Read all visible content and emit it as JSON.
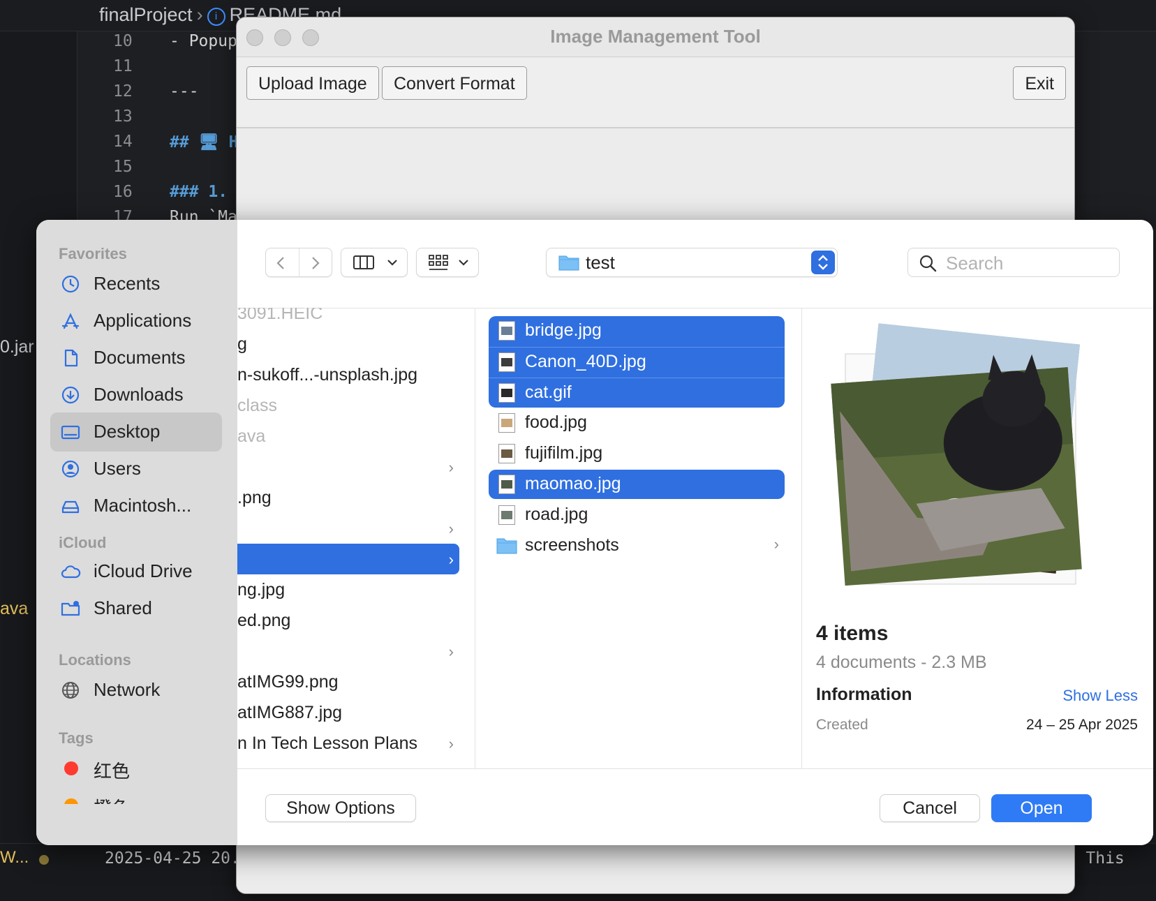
{
  "editor": {
    "breadcrumb_root": "finalProject",
    "breadcrumb_file": "README.md",
    "lines": [
      {
        "num": "10",
        "text": "- Popup"
      },
      {
        "num": "11",
        "text": ""
      },
      {
        "num": "12",
        "text": "---"
      },
      {
        "num": "13",
        "text": ""
      },
      {
        "num": "14",
        "text": "## 🖥 H"
      },
      {
        "num": "15",
        "text": ""
      },
      {
        "num": "16",
        "text": "### 1."
      },
      {
        "num": "17",
        "text": "Run `Ma"
      }
    ],
    "side_fragment_1": "0.jar",
    "side_fragment_2": "ava",
    "status_fragment": "W...",
    "terminal_text": "2025-04-25 20.",
    "terminal_right": "r.  This"
  },
  "java_window": {
    "title": "Image Management Tool",
    "upload_label": "Upload Image",
    "convert_label": "Convert Format",
    "exit_label": "Exit"
  },
  "dialog": {
    "sidebar": {
      "favorites_header": "Favorites",
      "favorites": [
        "Recents",
        "Applications",
        "Documents",
        "Downloads",
        "Desktop",
        "Users",
        "Macintosh..."
      ],
      "selected": "Desktop",
      "icloud_header": "iCloud",
      "icloud": [
        "iCloud Drive",
        "Shared"
      ],
      "locations_header": "Locations",
      "locations": [
        "Network"
      ],
      "tags_header": "Tags",
      "tags": [
        "红色",
        "橙色"
      ],
      "tag_colors": [
        "#ff3b30",
        "#ff9500"
      ]
    },
    "location": "test",
    "search_placeholder": "Search",
    "column1": [
      {
        "text": "3091.HEIC",
        "dim": true
      },
      {
        "text": "g",
        "dim": false
      },
      {
        "text": "n-sukoff...-unsplash.jpg",
        "dim": false
      },
      {
        "text": "class",
        "dim": true
      },
      {
        "text": "ava",
        "dim": true
      },
      {
        "text": "",
        "dim": false,
        "chevron": true
      },
      {
        "text": ".png",
        "dim": false
      },
      {
        "text": "",
        "dim": false,
        "chevron": true
      },
      {
        "text": "",
        "dim": false,
        "chevron": true,
        "selected": true
      },
      {
        "text": "ng.jpg",
        "dim": false
      },
      {
        "text": "ed.png",
        "dim": false
      },
      {
        "text": "",
        "dim": false,
        "chevron": true
      },
      {
        "text": "atIMG99.png",
        "dim": false
      },
      {
        "text": "atIMG887.jpg",
        "dim": false
      },
      {
        "text": "n In Tech Lesson Plans",
        "dim": false,
        "chevron": true
      }
    ],
    "files": [
      {
        "name": "bridge.jpg",
        "selected": true,
        "thumb": "#6a7f96"
      },
      {
        "name": "Canon_40D.jpg",
        "selected": true,
        "thumb": "#3d3d3d"
      },
      {
        "name": "cat.gif",
        "selected": true,
        "thumb": "#2a2a2a"
      },
      {
        "name": "food.jpg",
        "selected": false,
        "thumb": "#c9a77a"
      },
      {
        "name": "fujifilm.jpg",
        "selected": false,
        "thumb": "#6b5a44"
      },
      {
        "name": "maomao.jpg",
        "selected": true,
        "thumb": "#4f5c4a"
      },
      {
        "name": "road.jpg",
        "selected": false,
        "thumb": "#6c7a70"
      },
      {
        "name": "screenshots",
        "selected": false,
        "folder": true
      }
    ],
    "preview": {
      "count": "4 items",
      "summary": "4 documents - 2.3 MB",
      "info_header": "Information",
      "show_less": "Show Less",
      "created_label": "Created",
      "created_value": "24 – 25 Apr 2025"
    },
    "show_options_label": "Show Options",
    "cancel_label": "Cancel",
    "open_label": "Open"
  }
}
